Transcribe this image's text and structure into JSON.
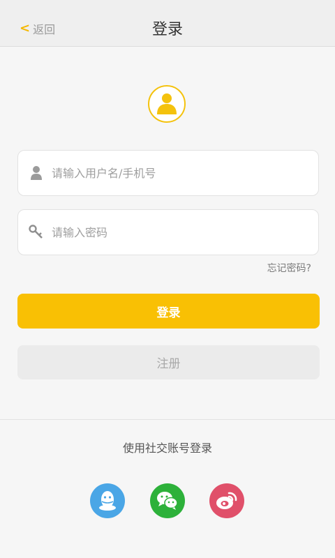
{
  "header": {
    "back_label": "返回",
    "title": "登录"
  },
  "form": {
    "username_placeholder": "请输入用户名/手机号",
    "password_placeholder": "请输入密码",
    "forgot_label": "忘记密码?",
    "login_label": "登录",
    "register_label": "注册"
  },
  "social": {
    "title": "使用社交账号登录",
    "items": [
      {
        "name": "qq-icon",
        "color": "#4aa6e6"
      },
      {
        "name": "wechat-icon",
        "color": "#2db13a"
      },
      {
        "name": "weibo-icon",
        "color": "#e0506a"
      }
    ]
  },
  "colors": {
    "accent": "#f9c004",
    "background": "#f6f6f6"
  }
}
